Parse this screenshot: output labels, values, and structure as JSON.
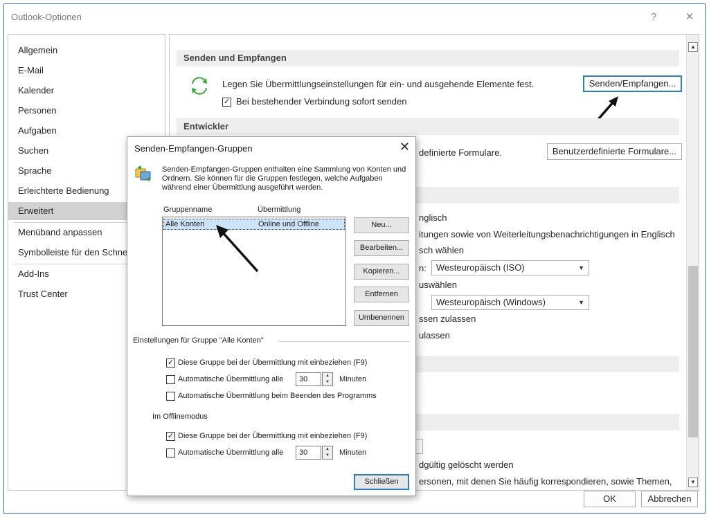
{
  "window": {
    "title": "Outlook-Optionen",
    "help_label": "?",
    "close_label": "✕"
  },
  "nav": {
    "items": [
      {
        "label": "Allgemein"
      },
      {
        "label": "E-Mail"
      },
      {
        "label": "Kalender"
      },
      {
        "label": "Personen"
      },
      {
        "label": "Aufgaben"
      },
      {
        "label": "Suchen"
      },
      {
        "label": "Sprache"
      },
      {
        "label": "Erleichterte Bedienung"
      },
      {
        "label": "Erweitert",
        "selected": true
      },
      {
        "label": "Menüband anpassen"
      },
      {
        "label": "Symbolleiste für den Schnellzugriff"
      },
      {
        "label": "Add-Ins"
      },
      {
        "label": "Trust Center"
      }
    ]
  },
  "content": {
    "send_receive": {
      "heading": "Senden und Empfangen",
      "description": "Legen Sie Übermittlungseinstellungen für ein- und ausgehende Elemente fest.",
      "button": "Senden/Empfangen...",
      "checkbox_label": "Bei bestehender Verbindung sofort senden",
      "checked": true
    },
    "developer": {
      "heading": "Entwickler",
      "description_fragment": "definierte Formulare.",
      "button": "Benutzerdefinierte Formulare..."
    },
    "partial": {
      "line1": "nglisch",
      "line2": "itungen sowie von Weiterleitungsbenachrichtigungen in Englisch",
      "line3": "sch wählen",
      "combo1_prefix": "n:",
      "combo1_value": "Westeuropäisch (ISO)",
      "line4": "uswählen",
      "combo2_value": "Westeuropäisch (Windows)",
      "line5": "ssen zulassen",
      "line6": "ulassen",
      "line7": "dgültig gelöscht werden",
      "line8": "ersonen, mit denen Sie häufig korrespondieren, sowie Themen,"
    }
  },
  "footer": {
    "ok": "OK",
    "cancel": "Abbrechen"
  },
  "dialog": {
    "title": "Senden-Empfangen-Gruppen",
    "close_label": "✕",
    "info": [
      "Senden-Empfangen-Gruppen enthalten eine Sammlung von Konten und",
      "Ordnern. Sie können für die Gruppen festlegen, welche Aufgaben",
      "während einer Übermittlung ausgeführt werden."
    ],
    "columns": {
      "name": "Gruppenname",
      "transfer": "Übermittlung"
    },
    "rows": [
      {
        "name": "Alle Konten",
        "transfer": "Online und Offline"
      }
    ],
    "buttons": {
      "new": "Neu...",
      "edit": "Bearbeiten...",
      "copy": "Kopieren...",
      "remove": "Entfernen",
      "rename": "Umbenennen",
      "close": "Schließen"
    },
    "group_settings_label": "Einstellungen für Gruppe \"Alle Konten\"",
    "online": {
      "include_label": "Diese Gruppe bei der Übermittlung mit einbeziehen (F9)",
      "include_checked": true,
      "auto_label": "Automatische Übermittlung alle",
      "auto_checked": false,
      "minutes_value": "30",
      "minutes_unit": "Minuten",
      "on_exit_label": "Automatische Übermittlung beim Beenden des Programms",
      "on_exit_checked": false
    },
    "offline": {
      "heading": "Im Offlinemodus",
      "include_label": "Diese Gruppe bei der Übermittlung mit einbeziehen (F9)",
      "include_checked": true,
      "auto_label": "Automatische Übermittlung alle",
      "auto_checked": false,
      "minutes_value": "30",
      "minutes_unit": "Minuten"
    }
  },
  "colors": {
    "accent": "#2b7cd3",
    "selected_nav": "#d2d2d2",
    "selected_row": "#cce4f7",
    "sync_icon": "#3aa53a"
  }
}
